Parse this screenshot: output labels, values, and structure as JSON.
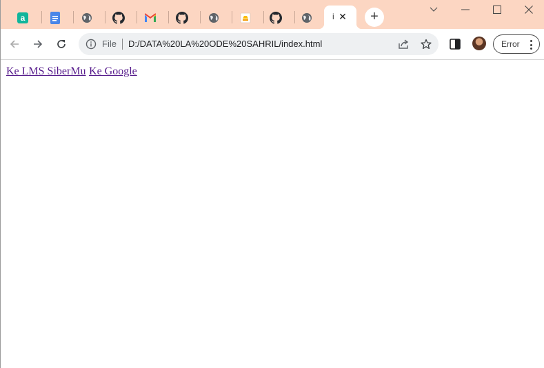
{
  "tabs": [
    {
      "icon": "amplitude-icon",
      "x": 0
    },
    {
      "icon": "docs-icon"
    },
    {
      "icon": "globe-icon"
    },
    {
      "icon": "github-icon"
    },
    {
      "icon": "gmail-icon"
    },
    {
      "icon": "github-icon"
    },
    {
      "icon": "globe-icon"
    },
    {
      "icon": "drive-file-icon"
    },
    {
      "icon": "github-icon"
    },
    {
      "icon": "globe-icon"
    }
  ],
  "active_tab": {
    "title": "i",
    "close": "✕"
  },
  "new_tab": "+",
  "window_controls": {
    "tab_search": "⌄",
    "minimize": "—",
    "maximize": "☐",
    "close": "✕"
  },
  "omnibox": {
    "scheme_label": "File",
    "url": "D:/DATA%20LA%20ODE%20SAHRIL/index.html"
  },
  "profile": {
    "status_label": "Error"
  },
  "page": {
    "link1": "Ke LMS SiberMu",
    "link2": "Ke Google"
  },
  "colors": {
    "tabstrip": "#fcd6c2",
    "link_visited": "#551a8b"
  }
}
